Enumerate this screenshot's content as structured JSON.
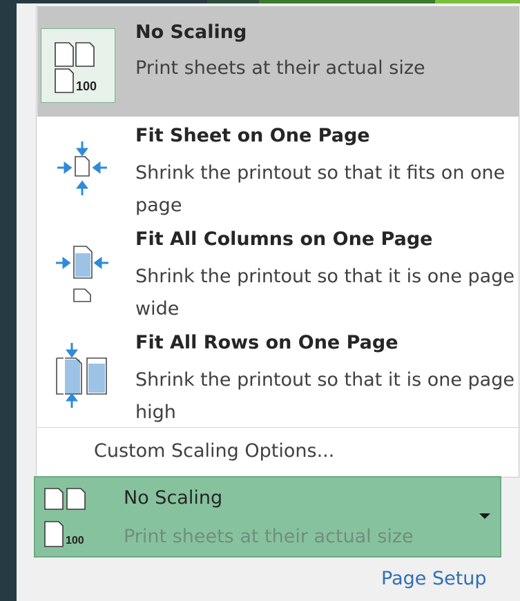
{
  "menu": {
    "items": [
      {
        "title": "No Scaling",
        "desc": "Print sheets at their actual size",
        "icon": "no-scaling-icon",
        "selected": true,
        "icon_label": "100"
      },
      {
        "title": "Fit Sheet on One Page",
        "desc": "Shrink the printout so that it fits on one page",
        "icon": "fit-sheet-icon",
        "selected": false
      },
      {
        "title": "Fit All Columns on One Page",
        "desc": "Shrink the printout so that it is one page wide",
        "icon": "fit-columns-icon",
        "selected": false
      },
      {
        "title": "Fit All Rows on One Page",
        "desc": "Shrink the printout so that it is one page high",
        "icon": "fit-rows-icon",
        "selected": false
      }
    ],
    "custom_label": "Custom Scaling Options..."
  },
  "combo": {
    "title": "No Scaling",
    "desc": "Print sheets at their actual size",
    "icon_label": "100"
  },
  "page_setup_label": "Page Setup",
  "colors": {
    "selected_bg": "#c5c5c5",
    "combo_bg": "#87c29e",
    "accent_blue": "#2e8bd8",
    "link": "#2f6fb3"
  }
}
